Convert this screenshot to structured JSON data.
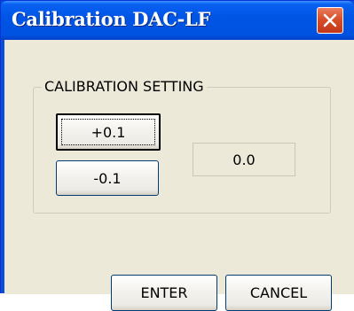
{
  "window": {
    "title": "Calibration DAC-LF",
    "close_icon": "close-x-icon",
    "close_color": "#d94e29",
    "titlebar_color": "#0055e5"
  },
  "calibration": {
    "group_label": "CALIBRATION SETTING",
    "increment_label": "+0.1",
    "decrement_label": "-0.1",
    "current_value": "0.0"
  },
  "footer": {
    "enter_label": "ENTER",
    "cancel_label": "CANCEL"
  }
}
